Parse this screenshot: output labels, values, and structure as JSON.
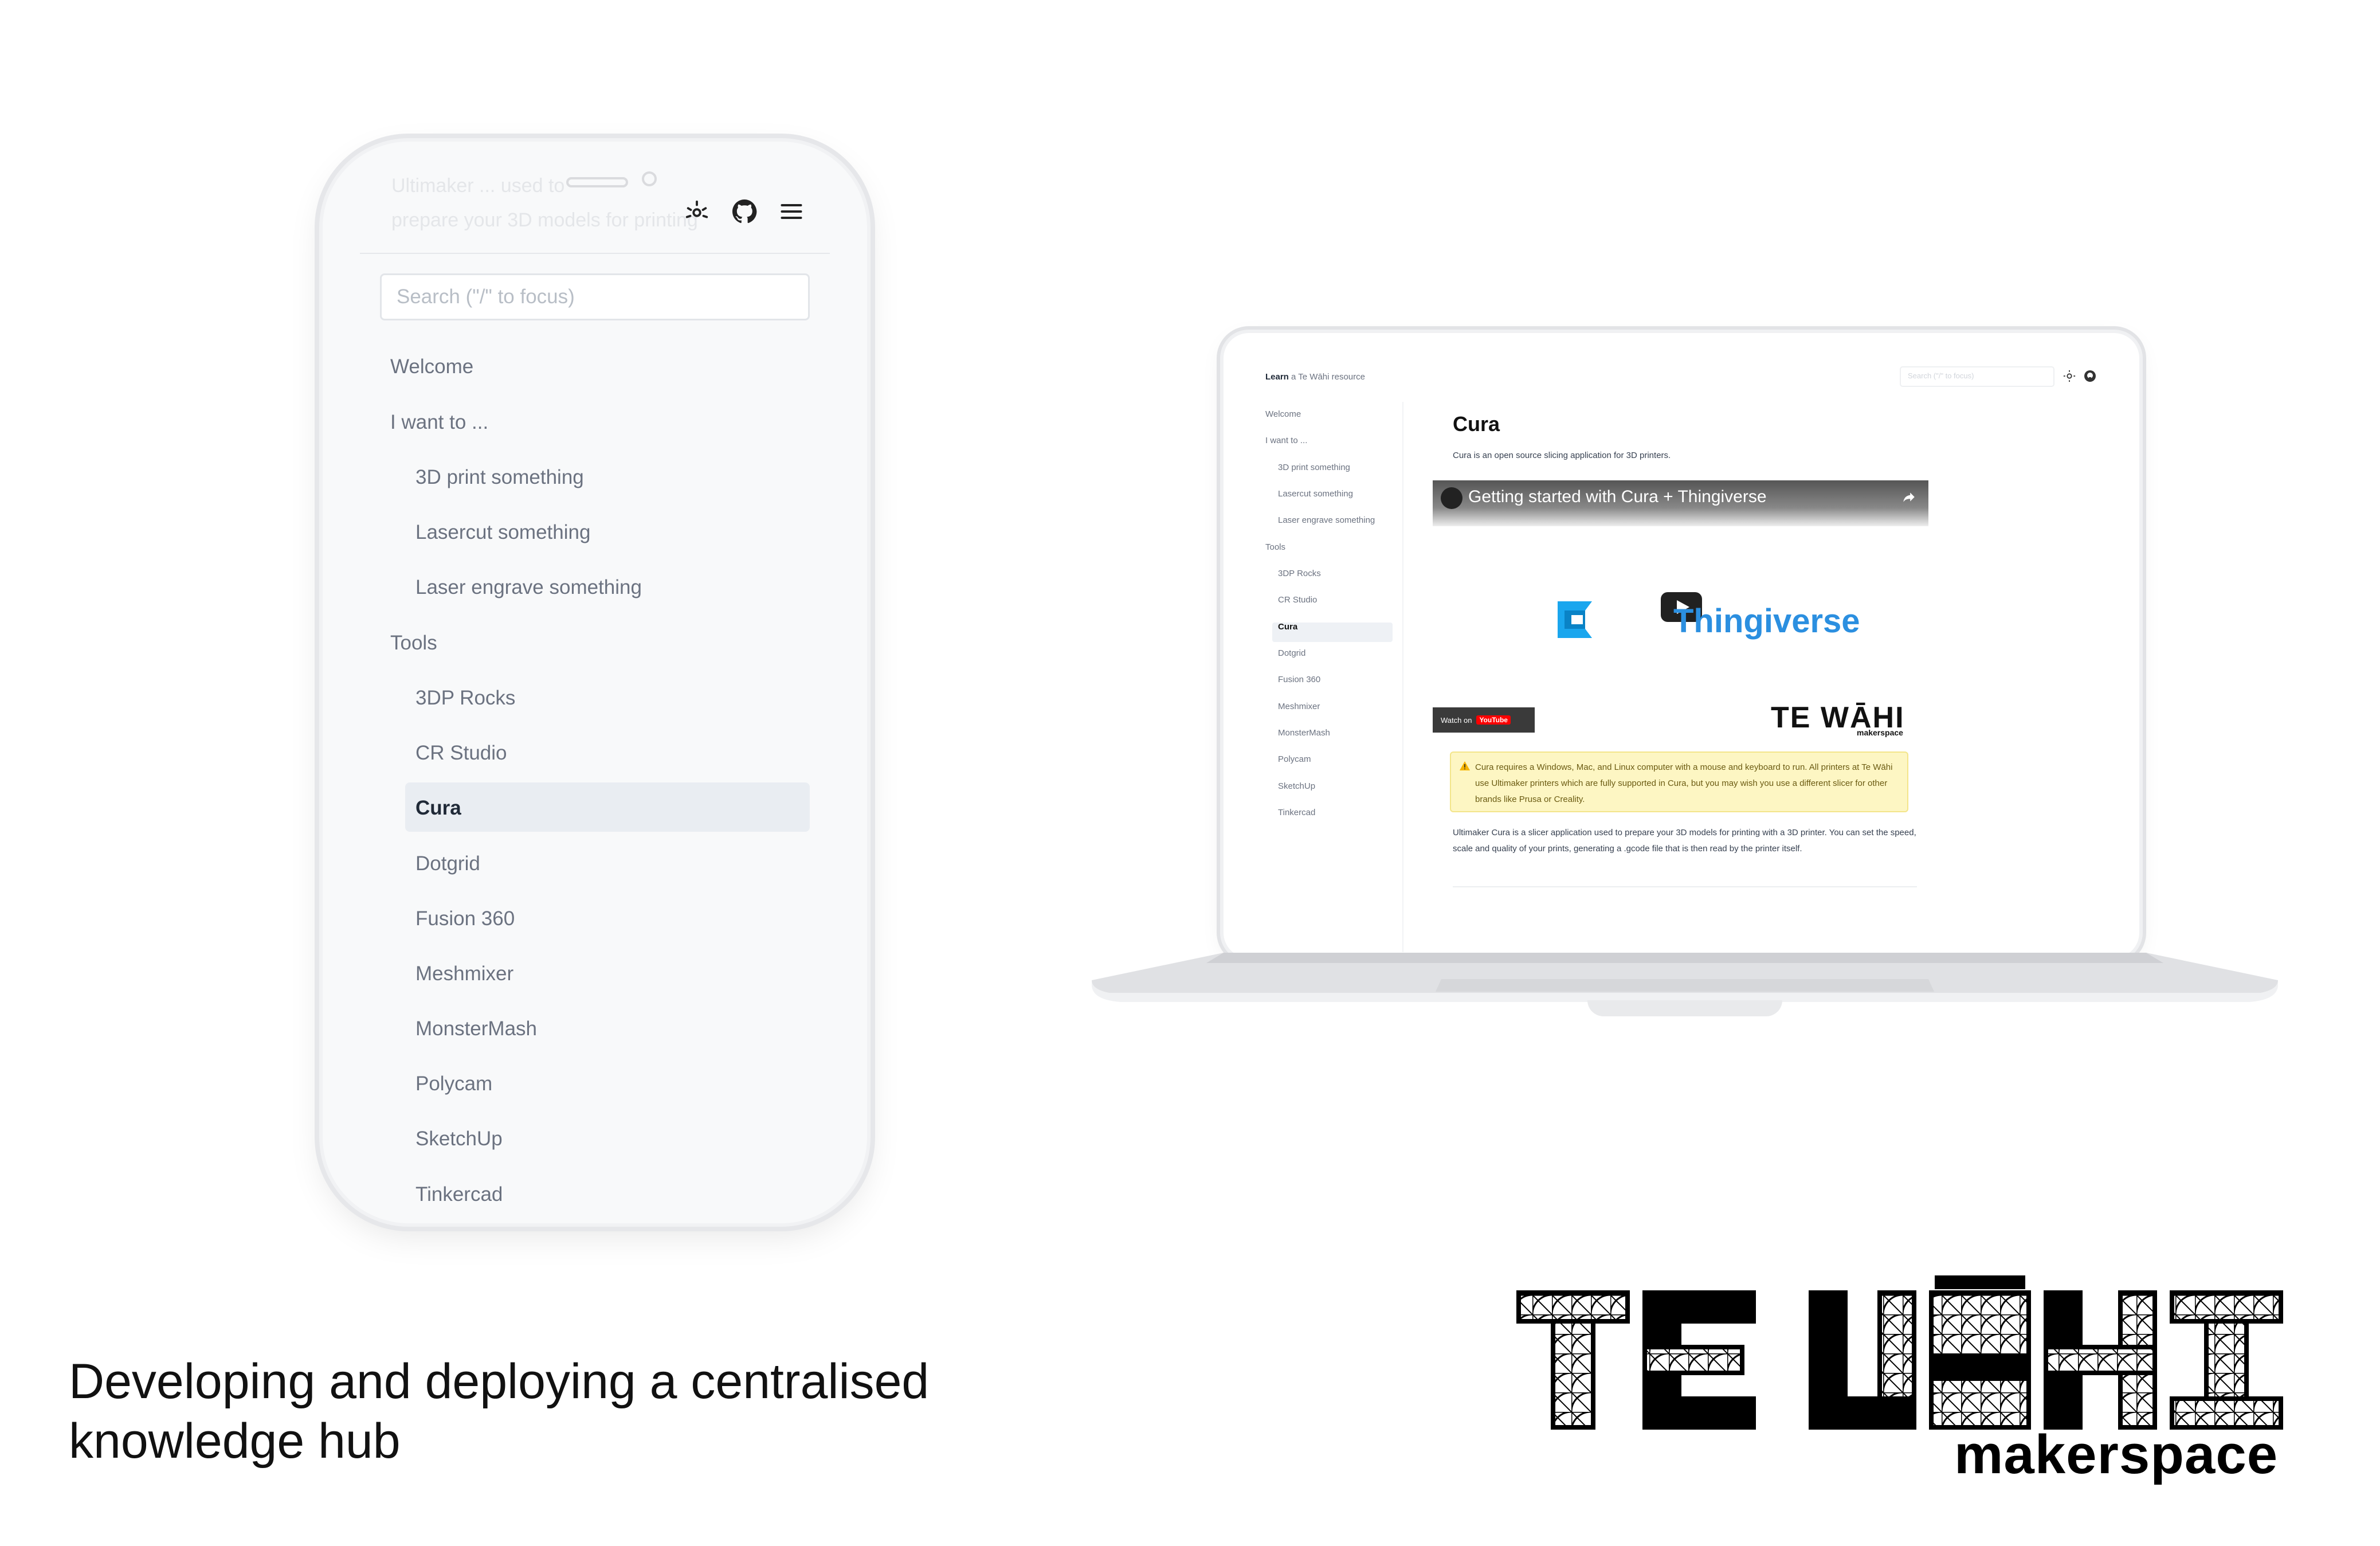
{
  "phone": {
    "ghost_line1": "Ultimaker ... used to",
    "ghost_line2": "prepare your 3D models for printing",
    "search_placeholder": "Search (\"/\" to focus)",
    "nav": [
      {
        "label": "Welcome"
      },
      {
        "label": "I want to ..."
      },
      {
        "label": "3D print something"
      },
      {
        "label": "Lasercut something"
      },
      {
        "label": "Laser engrave something"
      },
      {
        "label": "Tools"
      },
      {
        "label": "3DP Rocks"
      },
      {
        "label": "CR Studio"
      },
      {
        "label": "Cura"
      },
      {
        "label": "Dotgrid"
      },
      {
        "label": "Fusion 360"
      },
      {
        "label": "Meshmixer"
      },
      {
        "label": "MonsterMash"
      },
      {
        "label": "Polycam"
      },
      {
        "label": "SketchUp"
      },
      {
        "label": "Tinkercad"
      }
    ],
    "icons": [
      "sun-icon",
      "github-icon",
      "menu-icon"
    ]
  },
  "laptop": {
    "brand": "Learn",
    "brand_sub": "a Te Wāhi resource",
    "search_placeholder": "Search (\"/\" to focus)",
    "nav": [
      {
        "label": "Welcome"
      },
      {
        "label": "I want to ..."
      },
      {
        "label": "3D print something"
      },
      {
        "label": "Lasercut something"
      },
      {
        "label": "Laser engrave something"
      },
      {
        "label": "Tools"
      },
      {
        "label": "3DP Rocks"
      },
      {
        "label": "CR Studio"
      },
      {
        "label": "Cura"
      },
      {
        "label": "Dotgrid"
      },
      {
        "label": "Fusion 360"
      },
      {
        "label": "Meshmixer"
      },
      {
        "label": "MonsterMash"
      },
      {
        "label": "Polycam"
      },
      {
        "label": "SketchUp"
      },
      {
        "label": "Tinkercad"
      }
    ],
    "page_title": "Cura",
    "intro": "Cura is an open source slicing application for 3D printers.",
    "video": {
      "title": "Getting started with Cura + Thingiverse",
      "watch_on": "Watch on",
      "youtube": "YouTube",
      "thingiverse": "Thingiverse",
      "logo_text": "TE WĀHI",
      "logo_sub": "makerspace"
    },
    "warning": "Cura requires a Windows, Mac, and Linux computer with a mouse and keyboard to run. All printers at Te Wāhi use Ultimaker printers which are fully supported in Cura, but you may wish you use a different slicer for other brands like Prusa or Creality.",
    "paragraph": "Ultimaker Cura is a slicer application used to prepare your 3D models for printing with a 3D printer. You can set the speed, scale and quality of your prints, generating a .gcode file that is then read by the printer itself."
  },
  "caption": {
    "line1": "Developing and deploying a centralised",
    "line2": "knowledge hub"
  },
  "logo": {
    "text": "TE WĀHI",
    "sub": "makerspace"
  }
}
